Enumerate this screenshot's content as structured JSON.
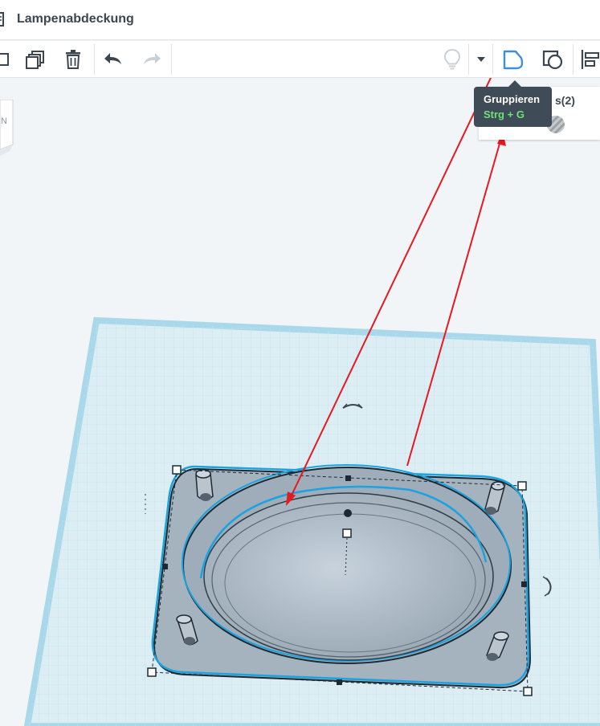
{
  "window": {
    "title": "Lampenabdeckung"
  },
  "toolbar": {
    "buttons": [
      {
        "name": "copy-icon"
      },
      {
        "name": "duplicate-icon"
      },
      {
        "name": "trash-icon"
      },
      {
        "name": "undo-icon"
      },
      {
        "name": "redo-icon"
      },
      {
        "name": "lightbulb-icon"
      },
      {
        "name": "dropdown-arrow-icon"
      },
      {
        "name": "group-icon"
      },
      {
        "name": "hole-shape-icon"
      },
      {
        "name": "align-icon"
      }
    ]
  },
  "tooltip": {
    "title": "Gruppieren",
    "shortcut": "Strg + G",
    "shortcut_color": "#6fe07a"
  },
  "shape_panel": {
    "title_fragment": "s(2)"
  },
  "viewcube": {
    "label": "N"
  },
  "colors": {
    "workplane": "#d7ecf3",
    "workplane_border": "#a9d8ea",
    "model_body": "#a8b6c2",
    "selection_outline": "#1aa3e0",
    "annotation_arrow": "#e8181f"
  }
}
